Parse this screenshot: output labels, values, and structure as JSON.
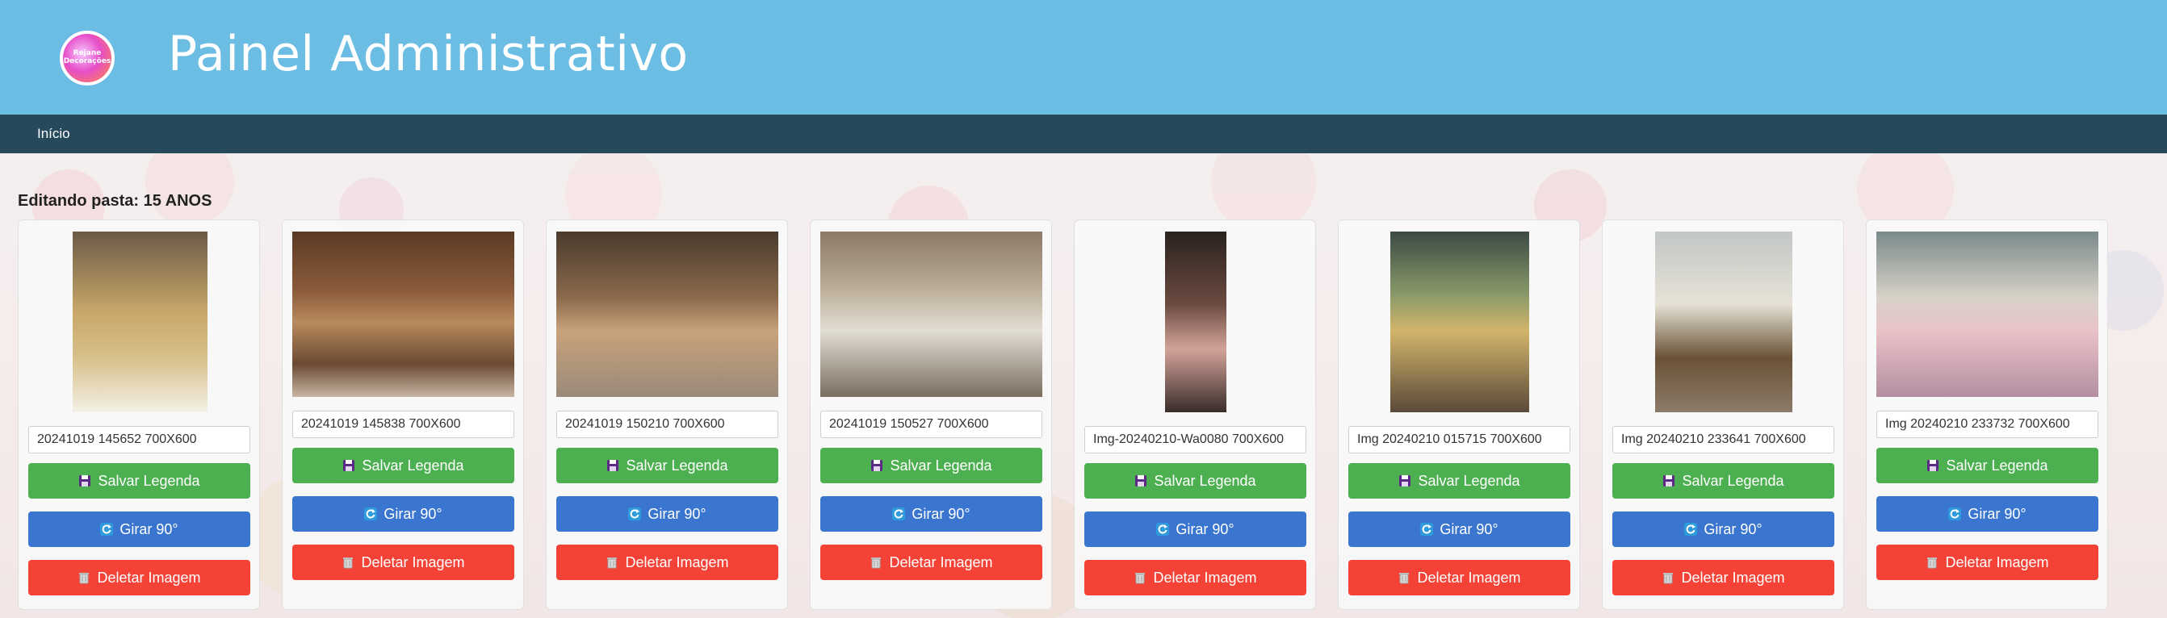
{
  "header": {
    "title": "Painel Administrativo",
    "logo_text": "Rejane Decorações",
    "bg_color": "#6bbde4"
  },
  "nav": {
    "bg_color": "#264a5c",
    "items": [
      {
        "label": "Início"
      }
    ]
  },
  "folder": {
    "heading": "Editando pasta: 15 ANOS"
  },
  "buttons": {
    "save_label": "Salvar Legenda",
    "rotate_label": "Girar 90°",
    "delete_label": "Deletar Imagem",
    "save_icon": "floppy-disk-icon",
    "rotate_icon": "rotate-icon",
    "delete_icon": "trash-icon",
    "save_color": "#4caf50",
    "rotate_color": "#3a76cf",
    "delete_color": "#f44336"
  },
  "cards": [
    {
      "caption": "20241019 145652 700X600",
      "orientation": "portrait"
    },
    {
      "caption": "20241019 145838 700X600",
      "orientation": "landscape"
    },
    {
      "caption": "20241019 150210 700X600",
      "orientation": "landscape"
    },
    {
      "caption": "20241019 150527 700X600",
      "orientation": "landscape"
    },
    {
      "caption": "Img-20240210-Wa0080 700X600",
      "orientation": "portrait"
    },
    {
      "caption": "Img 20240210 015715 700X600",
      "orientation": "portrait"
    },
    {
      "caption": "Img 20240210 233641 700X600",
      "orientation": "portrait"
    },
    {
      "caption": "Img 20240210 233732 700X600",
      "orientation": "landscape"
    }
  ]
}
